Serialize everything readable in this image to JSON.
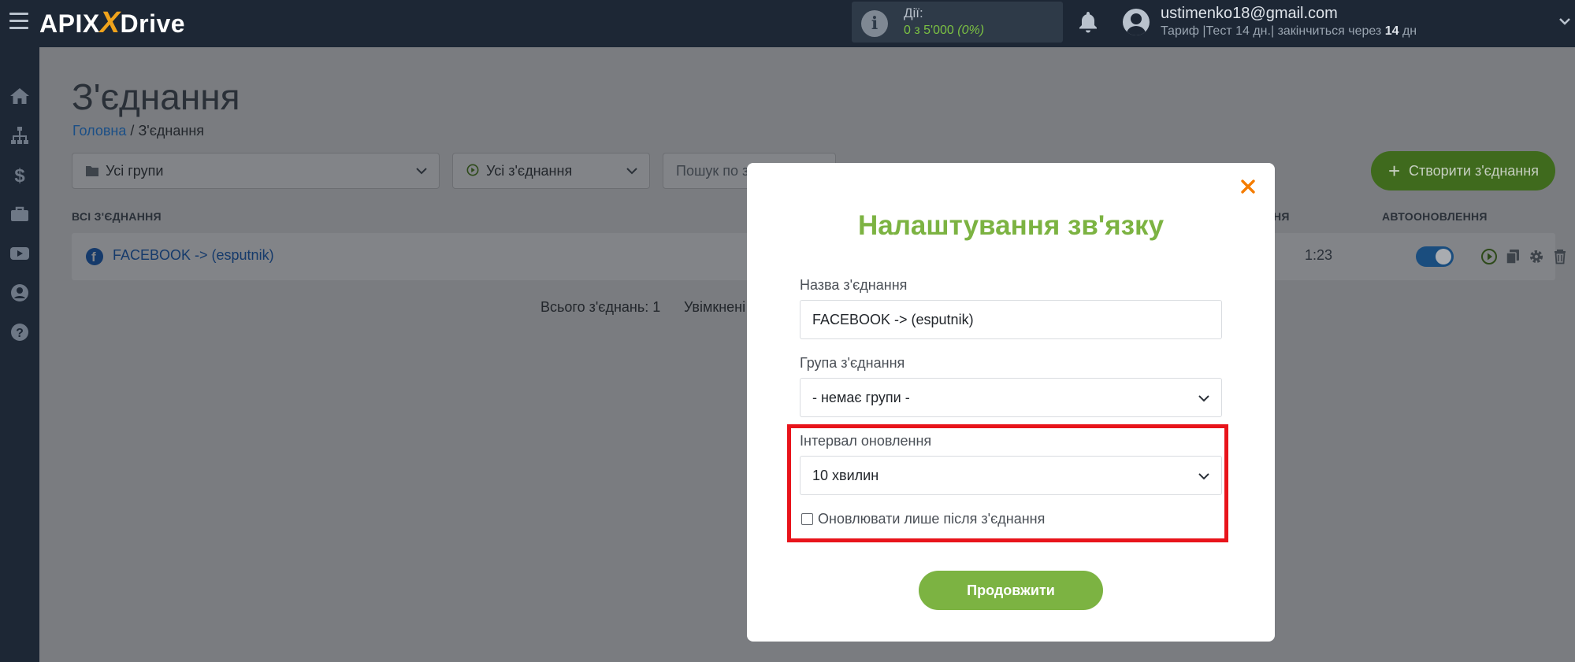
{
  "header": {
    "logo_left": "APIX",
    "logo_x": "X",
    "logo_right": "Drive",
    "actions_label": "Дії:",
    "actions_value": "0 з 5'000",
    "actions_percent": "(0%)",
    "user_email": "ustimenko18@gmail.com",
    "plan_prefix": "Тариф |Тест 14 дн.| закінчиться через",
    "plan_days": "14",
    "plan_suffix": "дн"
  },
  "page": {
    "title": "З'єднання",
    "breadcrumb_home": "Головна",
    "breadcrumb_sep": "/",
    "breadcrumb_current": "З'єднання"
  },
  "filters": {
    "groups": "Усі групи",
    "connections": "Усі з'єднання",
    "search_placeholder": "Пошук по з"
  },
  "create_button": "Створити з'єднання",
  "table": {
    "col_all": "ВСІ З'ЄДНАННЯ",
    "col_update": "НЯ",
    "col_auto": "АВТООНОВЛЕННЯ",
    "row_name": "FACEBOOK -> (esputnik)",
    "row_time": "1:23",
    "autoupdate_on": true
  },
  "totals": {
    "total": "Всього з'єднань: 1",
    "enabled": "Увімкнені з"
  },
  "modal": {
    "title": "Налаштування зв'язку",
    "name_label": "Назва з'єднання",
    "name_value": "FACEBOOK -> (esputnik)",
    "group_label": "Група з'єднання",
    "group_value": "- немає групи -",
    "interval_label": "Інтервал оновлення",
    "interval_value": "10 хвилин",
    "checkbox_label": "Оновлювати лише після з'єднання",
    "checkbox_checked": false,
    "continue_label": "Продовжити"
  },
  "colors": {
    "accent_green": "#7cb342",
    "close_orange": "#f57c00",
    "highlight_red": "#e8141b",
    "topbar": "#1d2735"
  }
}
